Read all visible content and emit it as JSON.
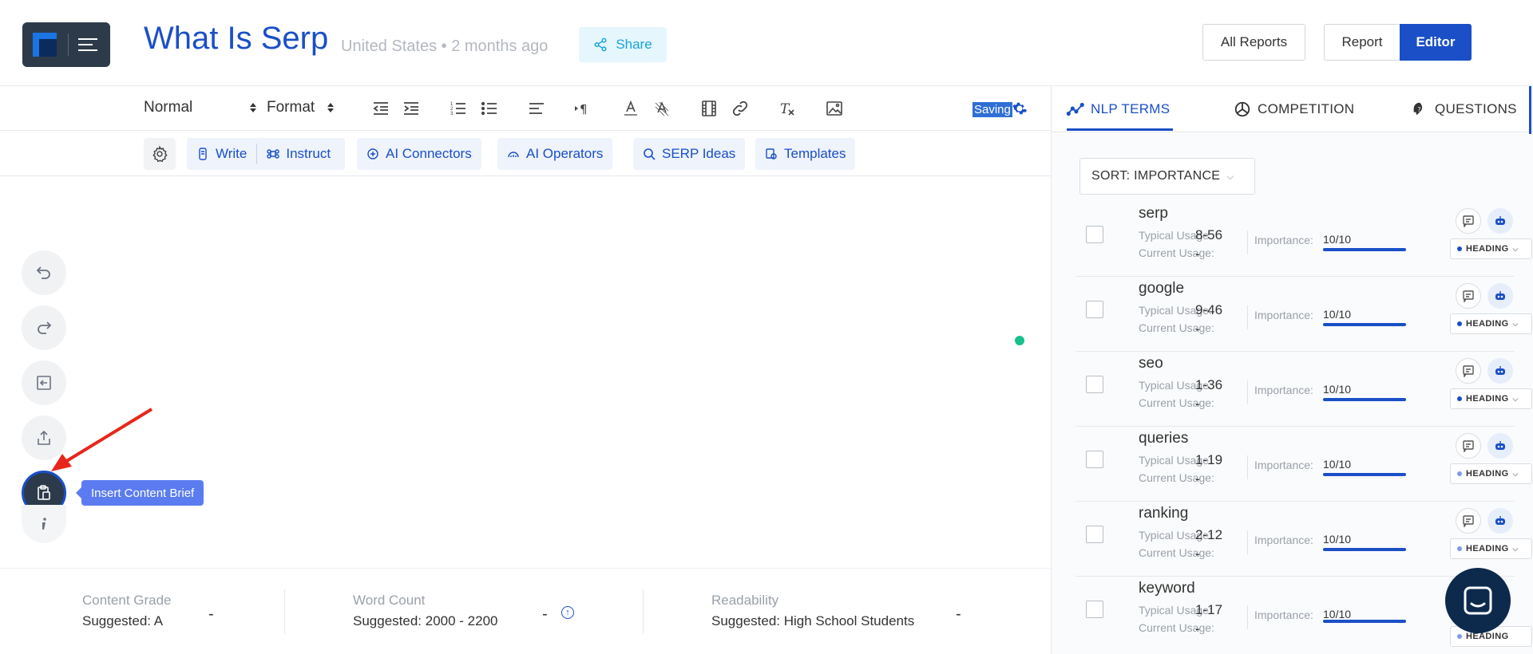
{
  "header": {
    "title": "What Is Serp",
    "meta_country": "United States",
    "meta_sep": "•",
    "meta_time": "2 months ago",
    "share_label": "Share",
    "all_reports_label": "All Reports",
    "report_label": "Report",
    "editor_label": "Editor"
  },
  "toolbar": {
    "style_select": "Normal",
    "format_select": "Format",
    "saving_label": "Saving"
  },
  "aibar": {
    "write": "Write",
    "instruct": "Instruct",
    "connectors": "AI Connectors",
    "operators": "AI Operators",
    "serp_ideas": "SERP Ideas",
    "templates": "Templates"
  },
  "side_tools": {
    "tooltip": "Insert Content Brief"
  },
  "metrics": {
    "content_grade": {
      "label": "Content Grade",
      "suggested": "Suggested: A",
      "value": "-"
    },
    "word_count": {
      "label": "Word Count",
      "suggested": "Suggested: 2000 - 2200",
      "value": "-"
    },
    "readability": {
      "label": "Readability",
      "suggested": "Suggested: High School Students",
      "value": "-"
    }
  },
  "right_panel": {
    "tabs": [
      {
        "label": "NLP TERMS"
      },
      {
        "label": "COMPETITION"
      },
      {
        "label": "QUESTIONS"
      }
    ],
    "sort_label": "SORT: IMPORTANCE",
    "typical_label": "Typical Usage:",
    "current_label": "Current Usage:",
    "importance_label": "Importance:",
    "heading_label": "HEADING",
    "terms": [
      {
        "name": "serp",
        "typical": "8-56",
        "current": "-",
        "importance": "10/10"
      },
      {
        "name": "google",
        "typical": "9-46",
        "current": "-",
        "importance": "10/10"
      },
      {
        "name": "seo",
        "typical": "1-36",
        "current": "-",
        "importance": "10/10"
      },
      {
        "name": "queries",
        "typical": "1-19",
        "current": "-",
        "importance": "10/10"
      },
      {
        "name": "ranking",
        "typical": "2-12",
        "current": "-",
        "importance": "10/10"
      },
      {
        "name": "keyword",
        "typical": "1-17",
        "current": "-",
        "importance": "10/10"
      }
    ]
  },
  "colors": {
    "brand_blue": "#1a4fc7",
    "dark_navy": "#2d3a4a",
    "status_green": "#17c08c"
  },
  "icons": [
    "logo-icon",
    "menu-icon",
    "share-icon",
    "outdent-icon",
    "indent-icon",
    "ordered-list-icon",
    "bullet-list-icon",
    "align-left-icon",
    "paragraph-icon",
    "font-color-icon",
    "highlight-icon",
    "film-icon",
    "link-icon",
    "clear-format-icon",
    "image-icon",
    "gear-icon",
    "undo-icon",
    "redo-icon",
    "import-icon",
    "export-icon",
    "clipboard-icon",
    "info-icon",
    "chat-icon"
  ]
}
